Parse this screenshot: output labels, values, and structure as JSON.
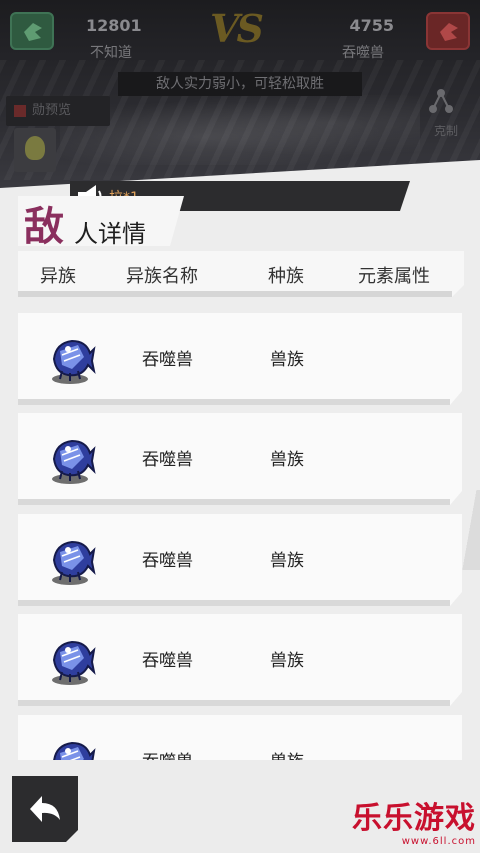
{
  "battle": {
    "player": {
      "power": "12801",
      "name": "不知道"
    },
    "enemy": {
      "power": "4755",
      "name": "吞噬兽"
    },
    "vs_label": "VS",
    "hint": "敌人实力弱小，可轻松取胜",
    "preview_label": "勋预览",
    "share_label": "克制"
  },
  "notice": {
    "text": "拉*1"
  },
  "panel": {
    "title_first": "敌",
    "title_rest": "人详情",
    "columns": [
      "异族",
      "异族名称",
      "种族",
      "元素属性"
    ]
  },
  "enemies": [
    {
      "name": "吞噬兽",
      "race": "兽族",
      "element": "",
      "icon": "blue-fish-monster-icon"
    },
    {
      "name": "吞噬兽",
      "race": "兽族",
      "element": "",
      "icon": "blue-fish-monster-icon"
    },
    {
      "name": "吞噬兽",
      "race": "兽族",
      "element": "",
      "icon": "blue-fish-monster-icon"
    },
    {
      "name": "吞噬兽",
      "race": "兽族",
      "element": "",
      "icon": "blue-fish-monster-icon"
    },
    {
      "name": "吞噬兽",
      "race": "兽族",
      "element": "",
      "icon": "blue-fish-monster-icon"
    }
  ],
  "footer": {
    "back_icon": "back-arrow-icon"
  },
  "watermark": {
    "logo": "乐乐游戏",
    "url": "www.6ll.com"
  },
  "colors": {
    "accent_title": "#8a2f5e",
    "notice_text": "#e0a15a",
    "watermark": "#c8102e",
    "panel_bg": "#ededed"
  }
}
